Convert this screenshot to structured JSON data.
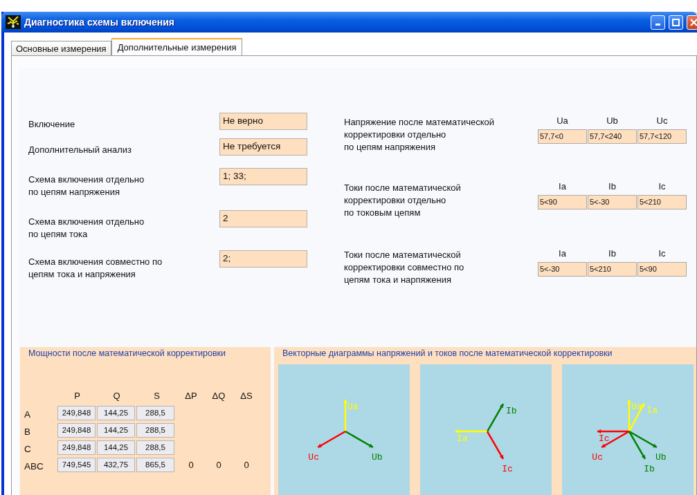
{
  "window": {
    "title": "Диагностика схемы включения"
  },
  "tabs": [
    {
      "label": "Основные измерения",
      "selected": false
    },
    {
      "label": "Дополнительные измерения",
      "selected": true
    }
  ],
  "results": [
    {
      "label": "Включение",
      "value": "Не верно"
    },
    {
      "label": "Дополнительный анализ",
      "value": "Не требуется"
    },
    {
      "label": "Схема включения отдельно\nпо цепям напряжения",
      "value": "1; 33;"
    },
    {
      "label": "Схема включения отдельно\nпо цепям тока",
      "value": "2"
    },
    {
      "label": "Схема включения совместно по\nцепям тока и напряжения",
      "value": "2;"
    }
  ],
  "corrected": [
    {
      "label": "Напряжение после математической\nкорректировки отдельно\nпо цепям напряжения",
      "headers": [
        "Ua",
        "Ub",
        "Uc"
      ],
      "values": [
        "57,7<0",
        "57,7<240",
        "57,7<120"
      ]
    },
    {
      "label": "Токи после математической\nкорректировки отдельно\nпо токовым цепям",
      "headers": [
        "Ia",
        "Ib",
        "Ic"
      ],
      "values": [
        "5<90",
        "5<-30",
        "5<210"
      ]
    },
    {
      "label": "Токи после математической\nкорректировки совместно по\nцепям тока и нарпяжения",
      "headers": [
        "Ia",
        "Ib",
        "Ic"
      ],
      "values": [
        "5<-30",
        "5<210",
        "5<90"
      ]
    }
  ],
  "power": {
    "title": "Мощности после математической корректировки",
    "columns": [
      "P",
      "Q",
      "S",
      "ΔP",
      "ΔQ",
      "ΔS"
    ],
    "rows": [
      {
        "label": "A",
        "values": [
          "249,848",
          "144,25",
          "288,5"
        ]
      },
      {
        "label": "B",
        "values": [
          "249,848",
          "144,25",
          "288,5"
        ]
      },
      {
        "label": "C",
        "values": [
          "249,848",
          "144,25",
          "288,5"
        ]
      },
      {
        "label": "ABC",
        "values": [
          "749,545",
          "432,75",
          "865,5"
        ],
        "deltas": [
          "0",
          "0",
          "0"
        ]
      }
    ]
  },
  "vector_diagrams": {
    "title": "Векторные диаграммы напряжений и токов после математической корректировки",
    "diagrams": [
      {
        "vectors": [
          {
            "label": "Ua",
            "color": "#ffff00"
          },
          {
            "label": "Ub",
            "color": "#008000"
          },
          {
            "label": "Uc",
            "color": "#ff0000"
          }
        ]
      },
      {
        "vectors": [
          {
            "label": "Ib",
            "color": "#008000"
          },
          {
            "label": "Ia",
            "color": "#ffff00"
          },
          {
            "label": "Ic",
            "color": "#ff0000"
          }
        ]
      },
      {
        "vectors": [
          {
            "label": "Ua",
            "color": "#ffff00"
          },
          {
            "label": "Ia",
            "color": "#ffff00"
          },
          {
            "label": "Ic",
            "color": "#ff0000"
          },
          {
            "label": "Uc",
            "color": "#ff0000"
          },
          {
            "label": "Ub",
            "color": "#008000"
          },
          {
            "label": "Ib",
            "color": "#008000"
          }
        ]
      }
    ]
  }
}
